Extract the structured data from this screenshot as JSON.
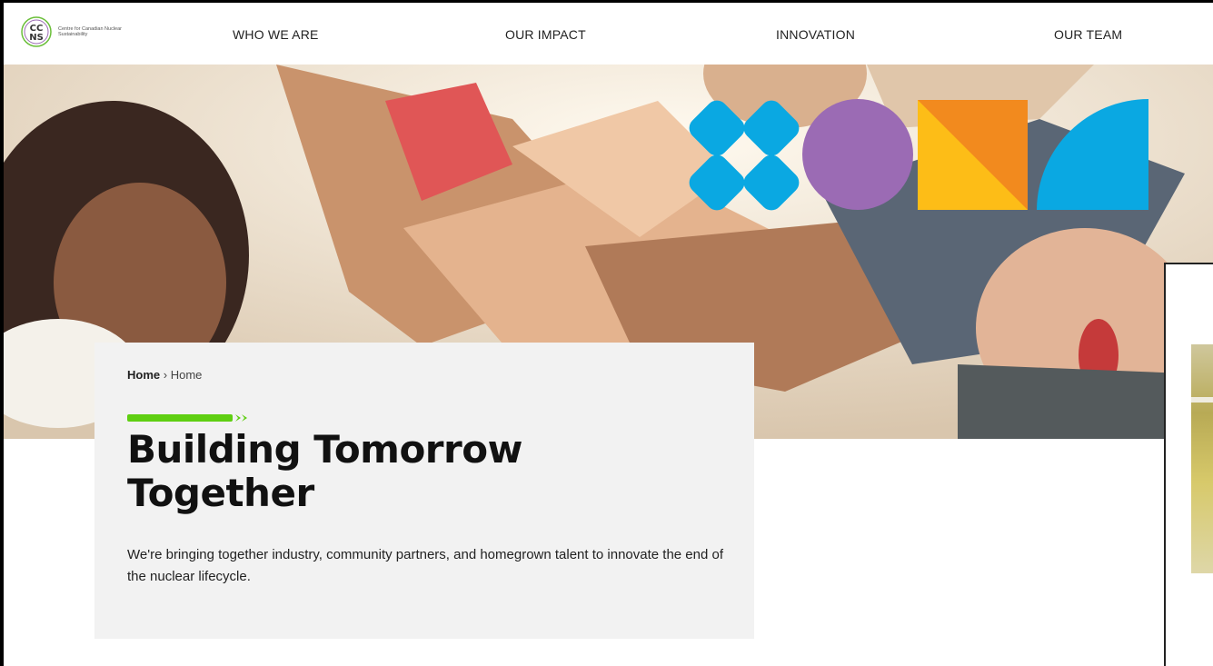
{
  "brand": {
    "logo_letters_top": "CC",
    "logo_letters_bottom": "NS",
    "logo_text": "Centre for Canadian Nuclear Sustainability"
  },
  "nav": {
    "items": [
      {
        "label": "WHO WE ARE"
      },
      {
        "label": "OUR IMPACT"
      },
      {
        "label": "INNOVATION"
      },
      {
        "label": "OUR TEAM"
      }
    ]
  },
  "breadcrumb": {
    "home": "Home",
    "separator": "›",
    "current": "Home"
  },
  "hero": {
    "headline_line1": "Building Tomorrow",
    "headline_line2": "Together",
    "body": "We're bringing together industry, community partners, and homegrown talent to innovate the end of the nuclear lifecycle."
  },
  "colors": {
    "accent_green": "#5fcf12",
    "shape_blue": "#0aa8e2",
    "shape_purple": "#9b6bb4",
    "shape_orange": "#f28a1e",
    "shape_yellow": "#fdbd17"
  }
}
